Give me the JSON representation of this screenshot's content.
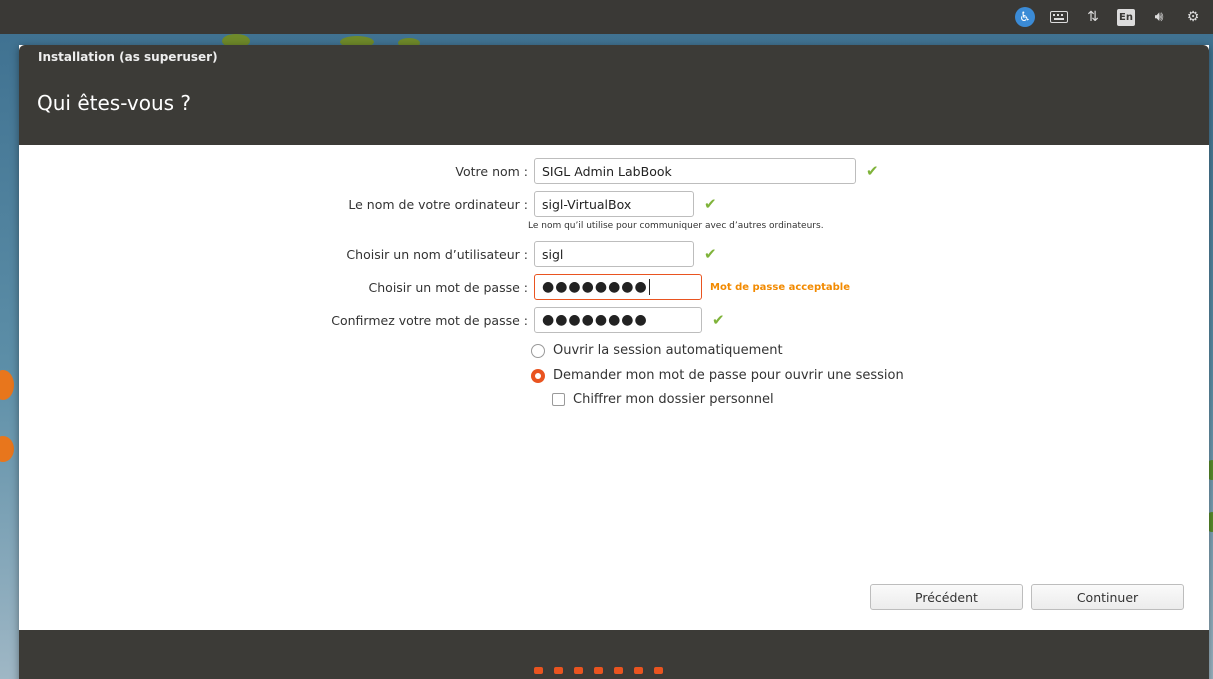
{
  "panel": {
    "icons": [
      "accessibility-icon",
      "keyboard-icon",
      "network-icon",
      "language-icon",
      "volume-icon",
      "settings-icon"
    ],
    "language_label": "En"
  },
  "window": {
    "title": "Installation (as superuser)",
    "heading": "Qui êtes-vous ?"
  },
  "form": {
    "name": {
      "label": "Votre nom :",
      "value": "SIGL Admin LabBook"
    },
    "computer": {
      "label": "Le nom de votre ordinateur :",
      "value": "sigl-VirtualBox",
      "hint": "Le nom qu’il utilise pour communiquer avec d’autres ordinateurs."
    },
    "username": {
      "label": "Choisir un nom d’utilisateur :",
      "value": "sigl"
    },
    "password": {
      "label": "Choisir un mot de passe :",
      "value": "●●●●●●●●",
      "strength": "Mot de passe acceptable"
    },
    "confirm": {
      "label": "Confirmez votre mot de passe :",
      "value": "●●●●●●●●"
    },
    "options": {
      "auto_login": "Ouvrir la session automatiquement",
      "require_password": "Demander mon mot de passe pour ouvrir une session",
      "encrypt_home": "Chiffrer mon dossier personnel"
    }
  },
  "buttons": {
    "back": "Précédent",
    "continue": "Continuer"
  },
  "progress": {
    "steps_total": 7
  },
  "colors": {
    "accent": "#e95420",
    "valid": "#7fb33a",
    "strength_warning": "#f28a00",
    "titlebar": "#3c3b37"
  }
}
